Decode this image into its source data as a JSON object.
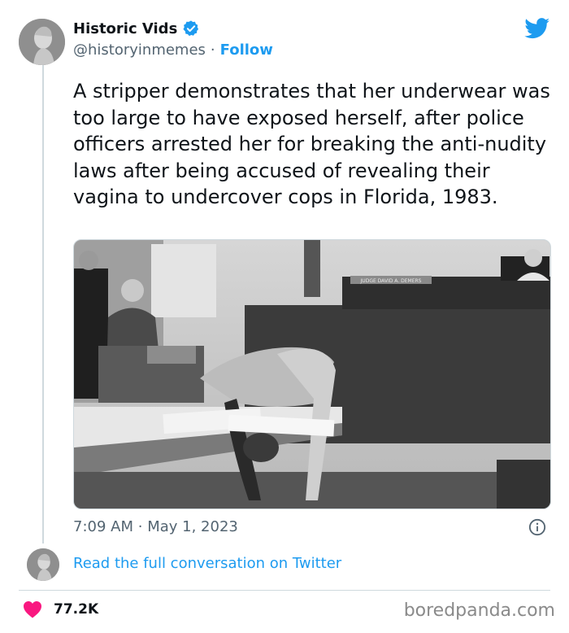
{
  "author": {
    "display_name": "Historic Vids",
    "handle": "@historyinmemes",
    "follow_label": "Follow",
    "separator": "·",
    "avatar_icon": "bust-portrait-icon",
    "verified_icon": "verified-badge-icon"
  },
  "brand": {
    "icon": "twitter-bird-icon",
    "color": "#1d9bf0"
  },
  "tweet": {
    "text": "A stripper demonstrates that her underwear was too large to have exposed herself, after police officers arrested her for breaking the anti-nudity laws after being accused of revealing their vagina to undercover cops in Florida, 1983.",
    "time": "7:09 AM",
    "separator": "·",
    "date": "May 1, 2023",
    "photo_sign": "JUDGE DAVID A. DEMERS"
  },
  "footer": {
    "read_link": "Read the full conversation on Twitter",
    "like_count": "77.2K",
    "like_color": "#f91880",
    "info_icon": "info-icon"
  },
  "watermark": {
    "text": "boredpanda.com"
  }
}
